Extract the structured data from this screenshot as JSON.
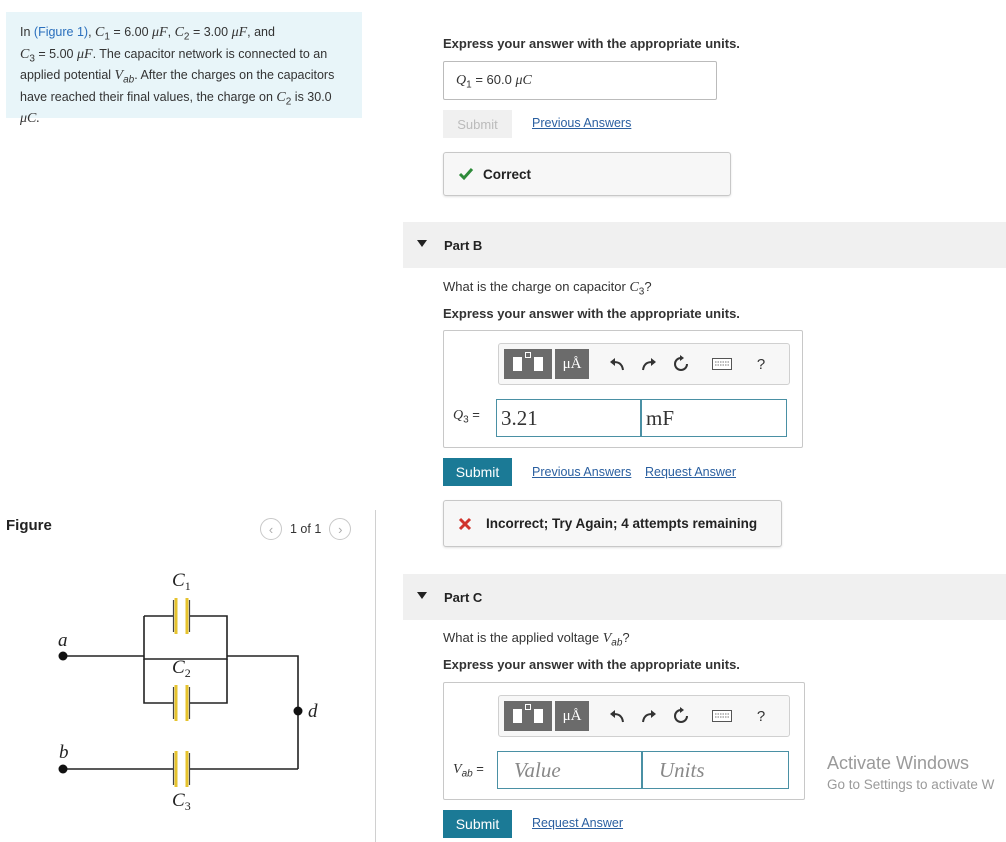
{
  "problem": {
    "prefix": "In ",
    "figure_link": "(Figure 1)",
    "c1": "6.00",
    "c2": "3.00",
    "c3": "5.00",
    "unit_text": "μF",
    "line2": ". The capacitor network is connected to an",
    "line3a": "applied potential ",
    "line3b": ". After the charges on the capacitors",
    "line4": "have reached their final values, the charge on ",
    "line4b": " is 30.0",
    "line5": "μC."
  },
  "figure": {
    "label": "Figure",
    "pager_text": "1 of 1",
    "labels": {
      "c1": "C",
      "c2": "C",
      "c3": "C",
      "a": "a",
      "b": "b",
      "d": "d"
    }
  },
  "part_a": {
    "instruction": "Express your answer with the appropriate units.",
    "answer_var": "Q",
    "answer_text": "= 60.0",
    "answer_unit": "μC",
    "submit_label": "Submit",
    "previous_answers": "Previous Answers",
    "feedback": "Correct"
  },
  "part_b": {
    "title": "Part B",
    "question_prefix": "What is the charge on capacitor ",
    "question_suffix": "?",
    "instruction": "Express your answer with the appropriate units.",
    "var_label": "Q",
    "value": "3.21",
    "units": "mF",
    "submit_label": "Submit",
    "previous_answers": "Previous Answers",
    "request_answer": "Request Answer",
    "feedback": "Incorrect; Try Again; 4 attempts remaining"
  },
  "part_c": {
    "title": "Part C",
    "question_prefix": "What is the applied voltage ",
    "question_suffix": "?",
    "instruction": "Express your answer with the appropriate units.",
    "var_label": "V",
    "value_placeholder": "Value",
    "units_placeholder": "Units",
    "submit_label": "Submit",
    "request_answer": "Request Answer"
  },
  "toolbar": {
    "units_symbol": "μÅ",
    "help": "?"
  },
  "watermark": {
    "title": "Activate Windows",
    "subtitle": "Go to Settings to activate W"
  },
  "colors": {
    "problem_bg": "#e8f5f9",
    "submit_bg": "#1b7a96",
    "link": "#2a5fa0",
    "correct": "#2e8b3a",
    "incorrect": "#d0342c"
  }
}
